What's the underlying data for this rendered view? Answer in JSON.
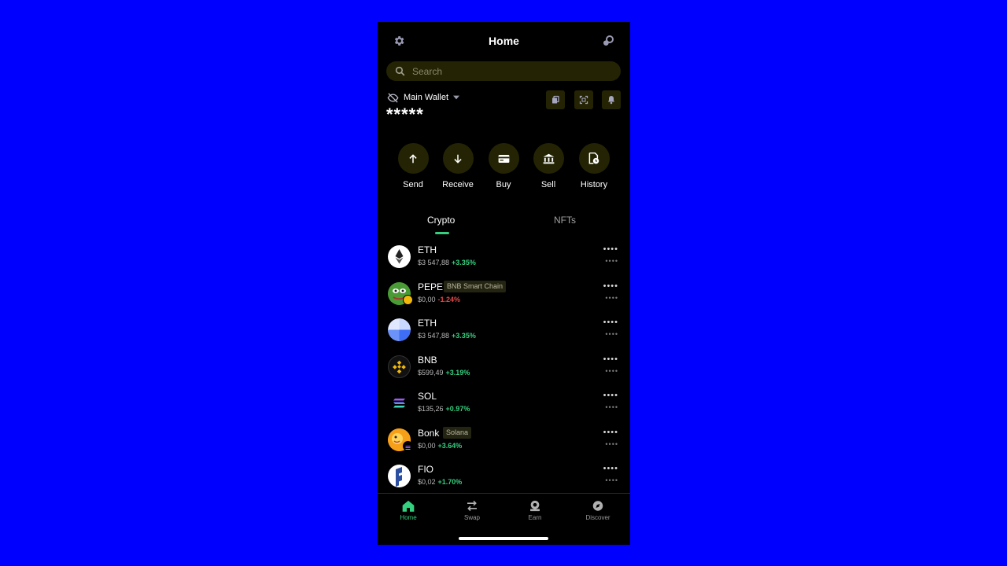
{
  "header": {
    "title": "Home"
  },
  "search": {
    "placeholder": "Search"
  },
  "wallet": {
    "name": "Main Wallet",
    "balance_masked": "*****"
  },
  "actions": [
    {
      "label": "Send",
      "icon": "arrow-up-icon"
    },
    {
      "label": "Receive",
      "icon": "arrow-down-icon"
    },
    {
      "label": "Buy",
      "icon": "card-icon"
    },
    {
      "label": "Sell",
      "icon": "bank-icon"
    },
    {
      "label": "History",
      "icon": "history-icon"
    }
  ],
  "tabs": [
    {
      "label": "Crypto",
      "active": true
    },
    {
      "label": "NFTs",
      "active": false
    }
  ],
  "assets": [
    {
      "symbol": "ETH",
      "badge": "",
      "price": "$3 547,88",
      "change": "+3.35%",
      "direction": "up",
      "balance_masked": "••••",
      "value_masked": "••••",
      "icon": "ethereum-logo-icon"
    },
    {
      "symbol": "PEPE",
      "badge": "BNB Smart Chain",
      "price": "$0,00",
      "change": "-1.24%",
      "direction": "down",
      "balance_masked": "••••",
      "value_masked": "••••",
      "icon": "pepe-logo-icon"
    },
    {
      "symbol": "ETH",
      "badge": "",
      "price": "$3 547,88",
      "change": "+3.35%",
      "direction": "up",
      "balance_masked": "••••",
      "value_masked": "••••",
      "icon": "ethereum-layer2-logo-icon"
    },
    {
      "symbol": "BNB",
      "badge": "",
      "price": "$599,49",
      "change": "+3.19%",
      "direction": "up",
      "balance_masked": "••••",
      "value_masked": "••••",
      "icon": "bnb-logo-icon"
    },
    {
      "symbol": "SOL",
      "badge": "",
      "price": "$135,26",
      "change": "+0.97%",
      "direction": "up",
      "balance_masked": "••••",
      "value_masked": "••••",
      "icon": "solana-logo-icon"
    },
    {
      "symbol": "Bonk",
      "badge": "Solana",
      "price": "$0,00",
      "change": "+3.64%",
      "direction": "up",
      "balance_masked": "••••",
      "value_masked": "••••",
      "icon": "bonk-logo-icon"
    },
    {
      "symbol": "FIO",
      "badge": "",
      "price": "$0,02",
      "change": "+1.70%",
      "direction": "up",
      "balance_masked": "••••",
      "value_masked": "••••",
      "icon": "fio-logo-icon"
    }
  ],
  "nav": [
    {
      "label": "Home",
      "active": true,
      "icon": "home-icon"
    },
    {
      "label": "Swap",
      "active": false,
      "icon": "swap-icon"
    },
    {
      "label": "Earn",
      "active": false,
      "icon": "earn-icon"
    },
    {
      "label": "Discover",
      "active": false,
      "icon": "discover-icon"
    }
  ],
  "colors": {
    "accent": "#35d07f",
    "negative": "#e54848",
    "surface": "#242404",
    "background_outer": "#0000ff"
  }
}
